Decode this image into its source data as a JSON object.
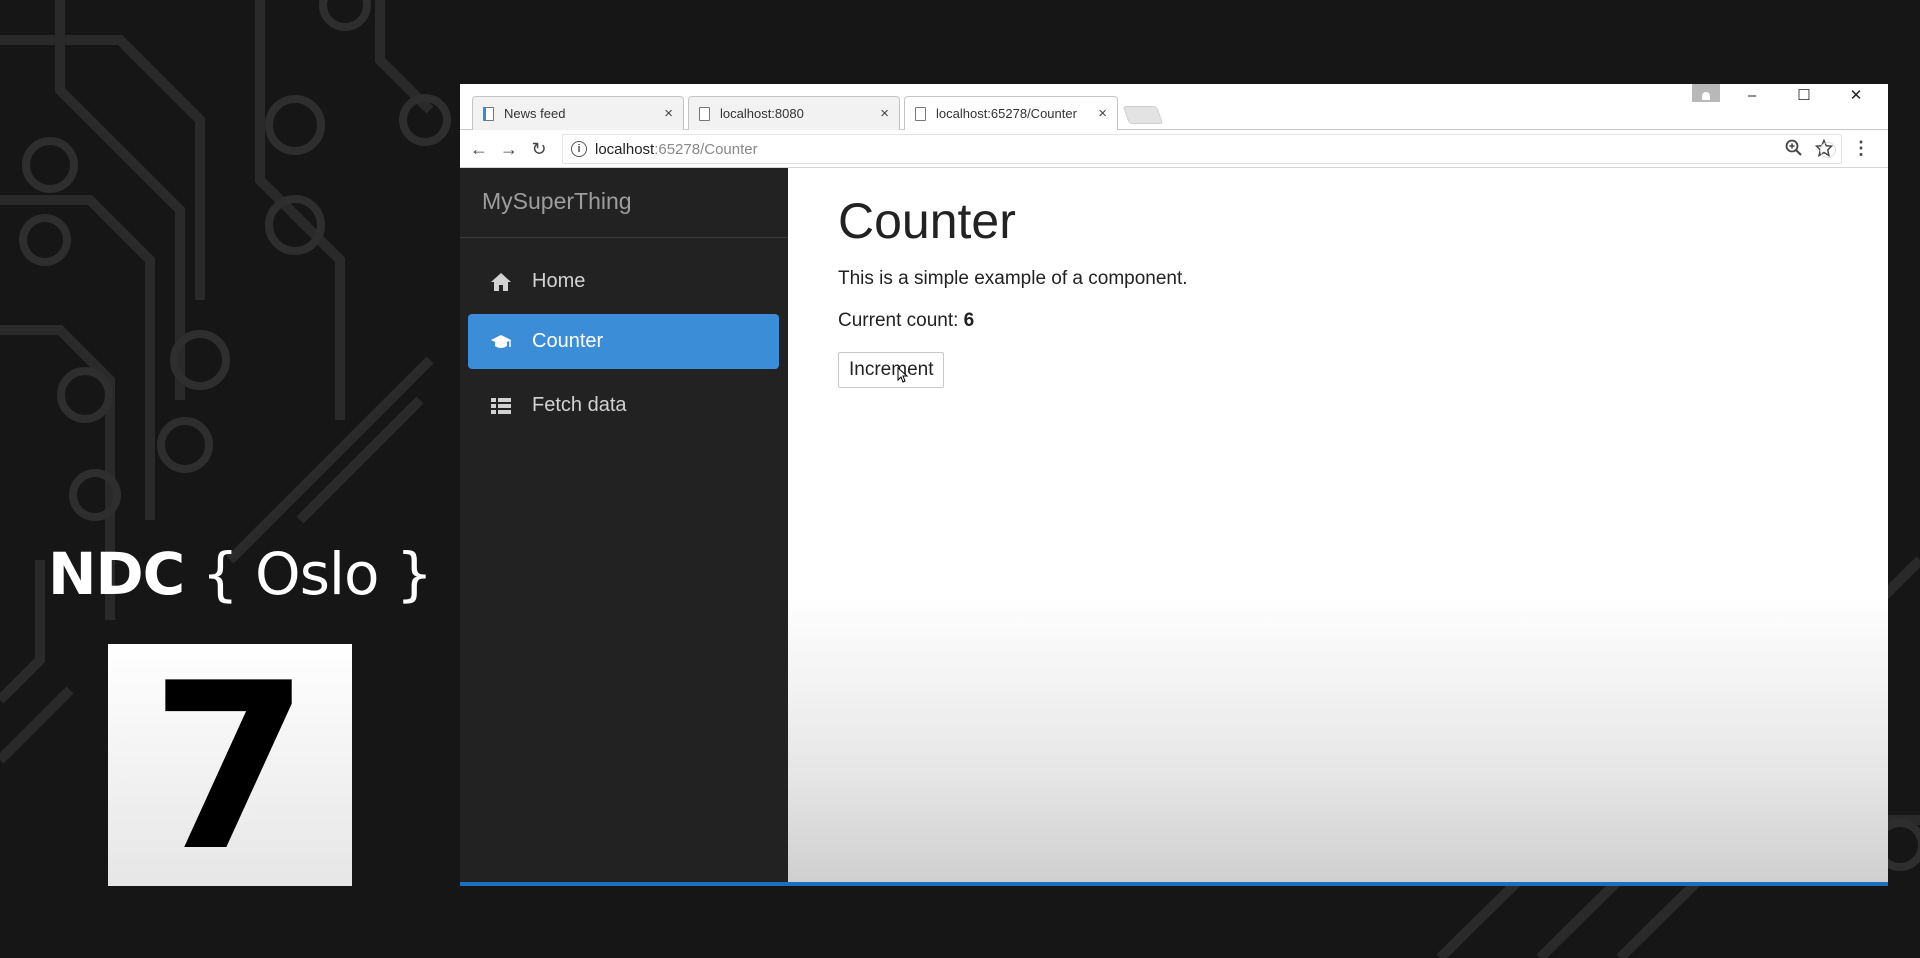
{
  "branding": {
    "event_bold": "NDC",
    "event_light": "{ Oslo }",
    "day_number": "7"
  },
  "browser": {
    "tabs": [
      {
        "label": "News feed",
        "close": "×"
      },
      {
        "label": "localhost:8080",
        "close": "×"
      },
      {
        "label": "localhost:65278/Counter",
        "close": "×"
      }
    ],
    "window_controls": {
      "minimize": "–",
      "maximize": "☐",
      "close": "✕"
    },
    "nav": {
      "back": "←",
      "forward": "→",
      "reload": "↻"
    },
    "address": {
      "info": "i",
      "host": "localhost",
      "rest": ":65278/Counter"
    },
    "icons": {
      "zoom": "zoom-icon",
      "star": "star-icon",
      "menu": "⋮"
    }
  },
  "app": {
    "brand": "MySuperThing",
    "nav_items": [
      {
        "label": "Home",
        "icon": "home-icon"
      },
      {
        "label": "Counter",
        "icon": "graduation-cap-icon"
      },
      {
        "label": "Fetch data",
        "icon": "list-icon"
      }
    ],
    "page_title": "Counter",
    "description": "This is a simple example of a component.",
    "count_label": "Current count: ",
    "count_value": "6",
    "increment_label": "Increment",
    "accent_color": "#3a8dd6"
  }
}
